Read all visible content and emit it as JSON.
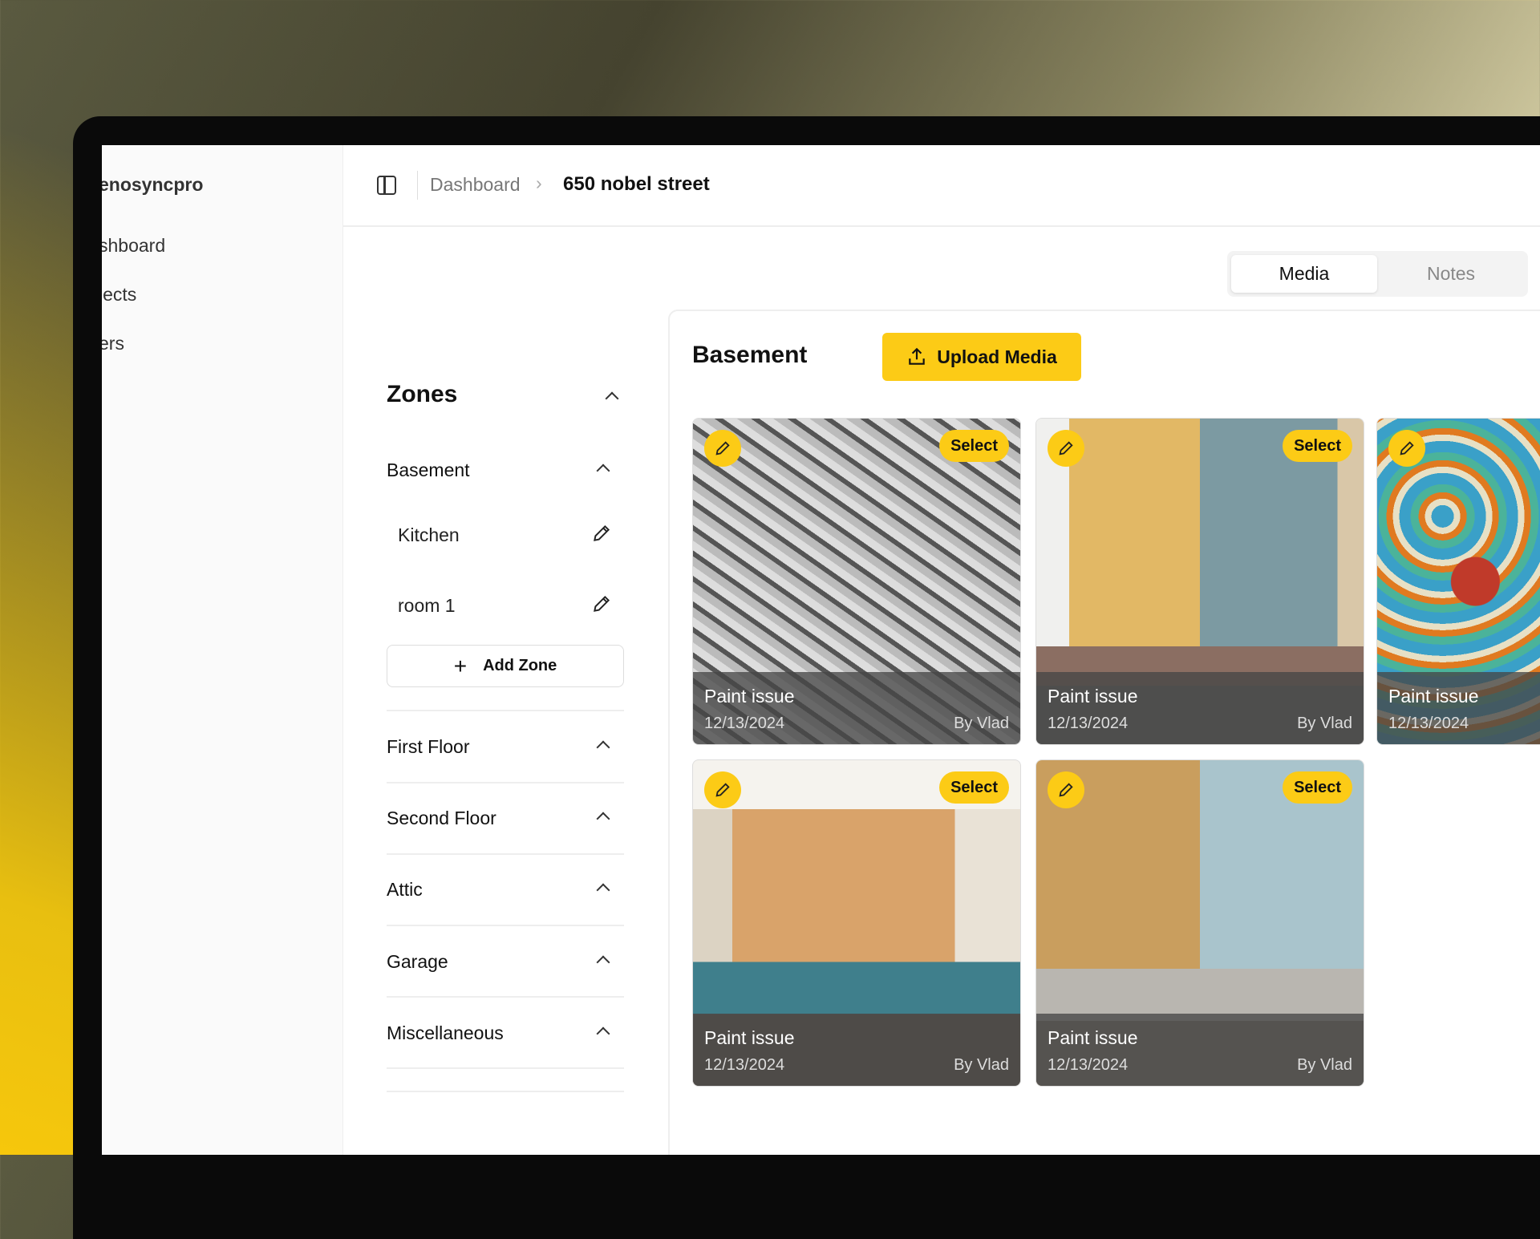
{
  "brand": "enosyncpro",
  "sidebar": {
    "items": [
      {
        "label": "shboard"
      },
      {
        "label": "jects"
      },
      {
        "label": "ers"
      }
    ]
  },
  "breadcrumb": {
    "parent": "Dashboard",
    "current": "650 nobel street"
  },
  "tabs": [
    {
      "label": "Media",
      "active": true
    },
    {
      "label": "Notes",
      "active": false
    }
  ],
  "zones": {
    "title": "Zones",
    "groups": [
      {
        "label": "Basement",
        "children": [
          {
            "label": "Kitchen"
          },
          {
            "label": "room 1"
          }
        ]
      },
      {
        "label": "First Floor"
      },
      {
        "label": "Second Floor"
      },
      {
        "label": "Attic"
      },
      {
        "label": "Garage"
      },
      {
        "label": "Miscellaneous"
      }
    ],
    "add_label": "Add Zone"
  },
  "media": {
    "title": "Basement",
    "upload_label": "Upload Media",
    "select_label": "Select",
    "cards": [
      {
        "title": "Paint issue",
        "date": "12/13/2024",
        "author": "By Vlad"
      },
      {
        "title": "Paint issue",
        "date": "12/13/2024",
        "author": "By Vlad"
      },
      {
        "title": "Paint issue",
        "date": "12/13/2024",
        "author": ""
      },
      {
        "title": "Paint issue",
        "date": "12/13/2024",
        "author": "By Vlad"
      },
      {
        "title": "Paint issue",
        "date": "12/13/2024",
        "author": "By Vlad"
      }
    ]
  },
  "colors": {
    "accent": "#fccb16"
  }
}
